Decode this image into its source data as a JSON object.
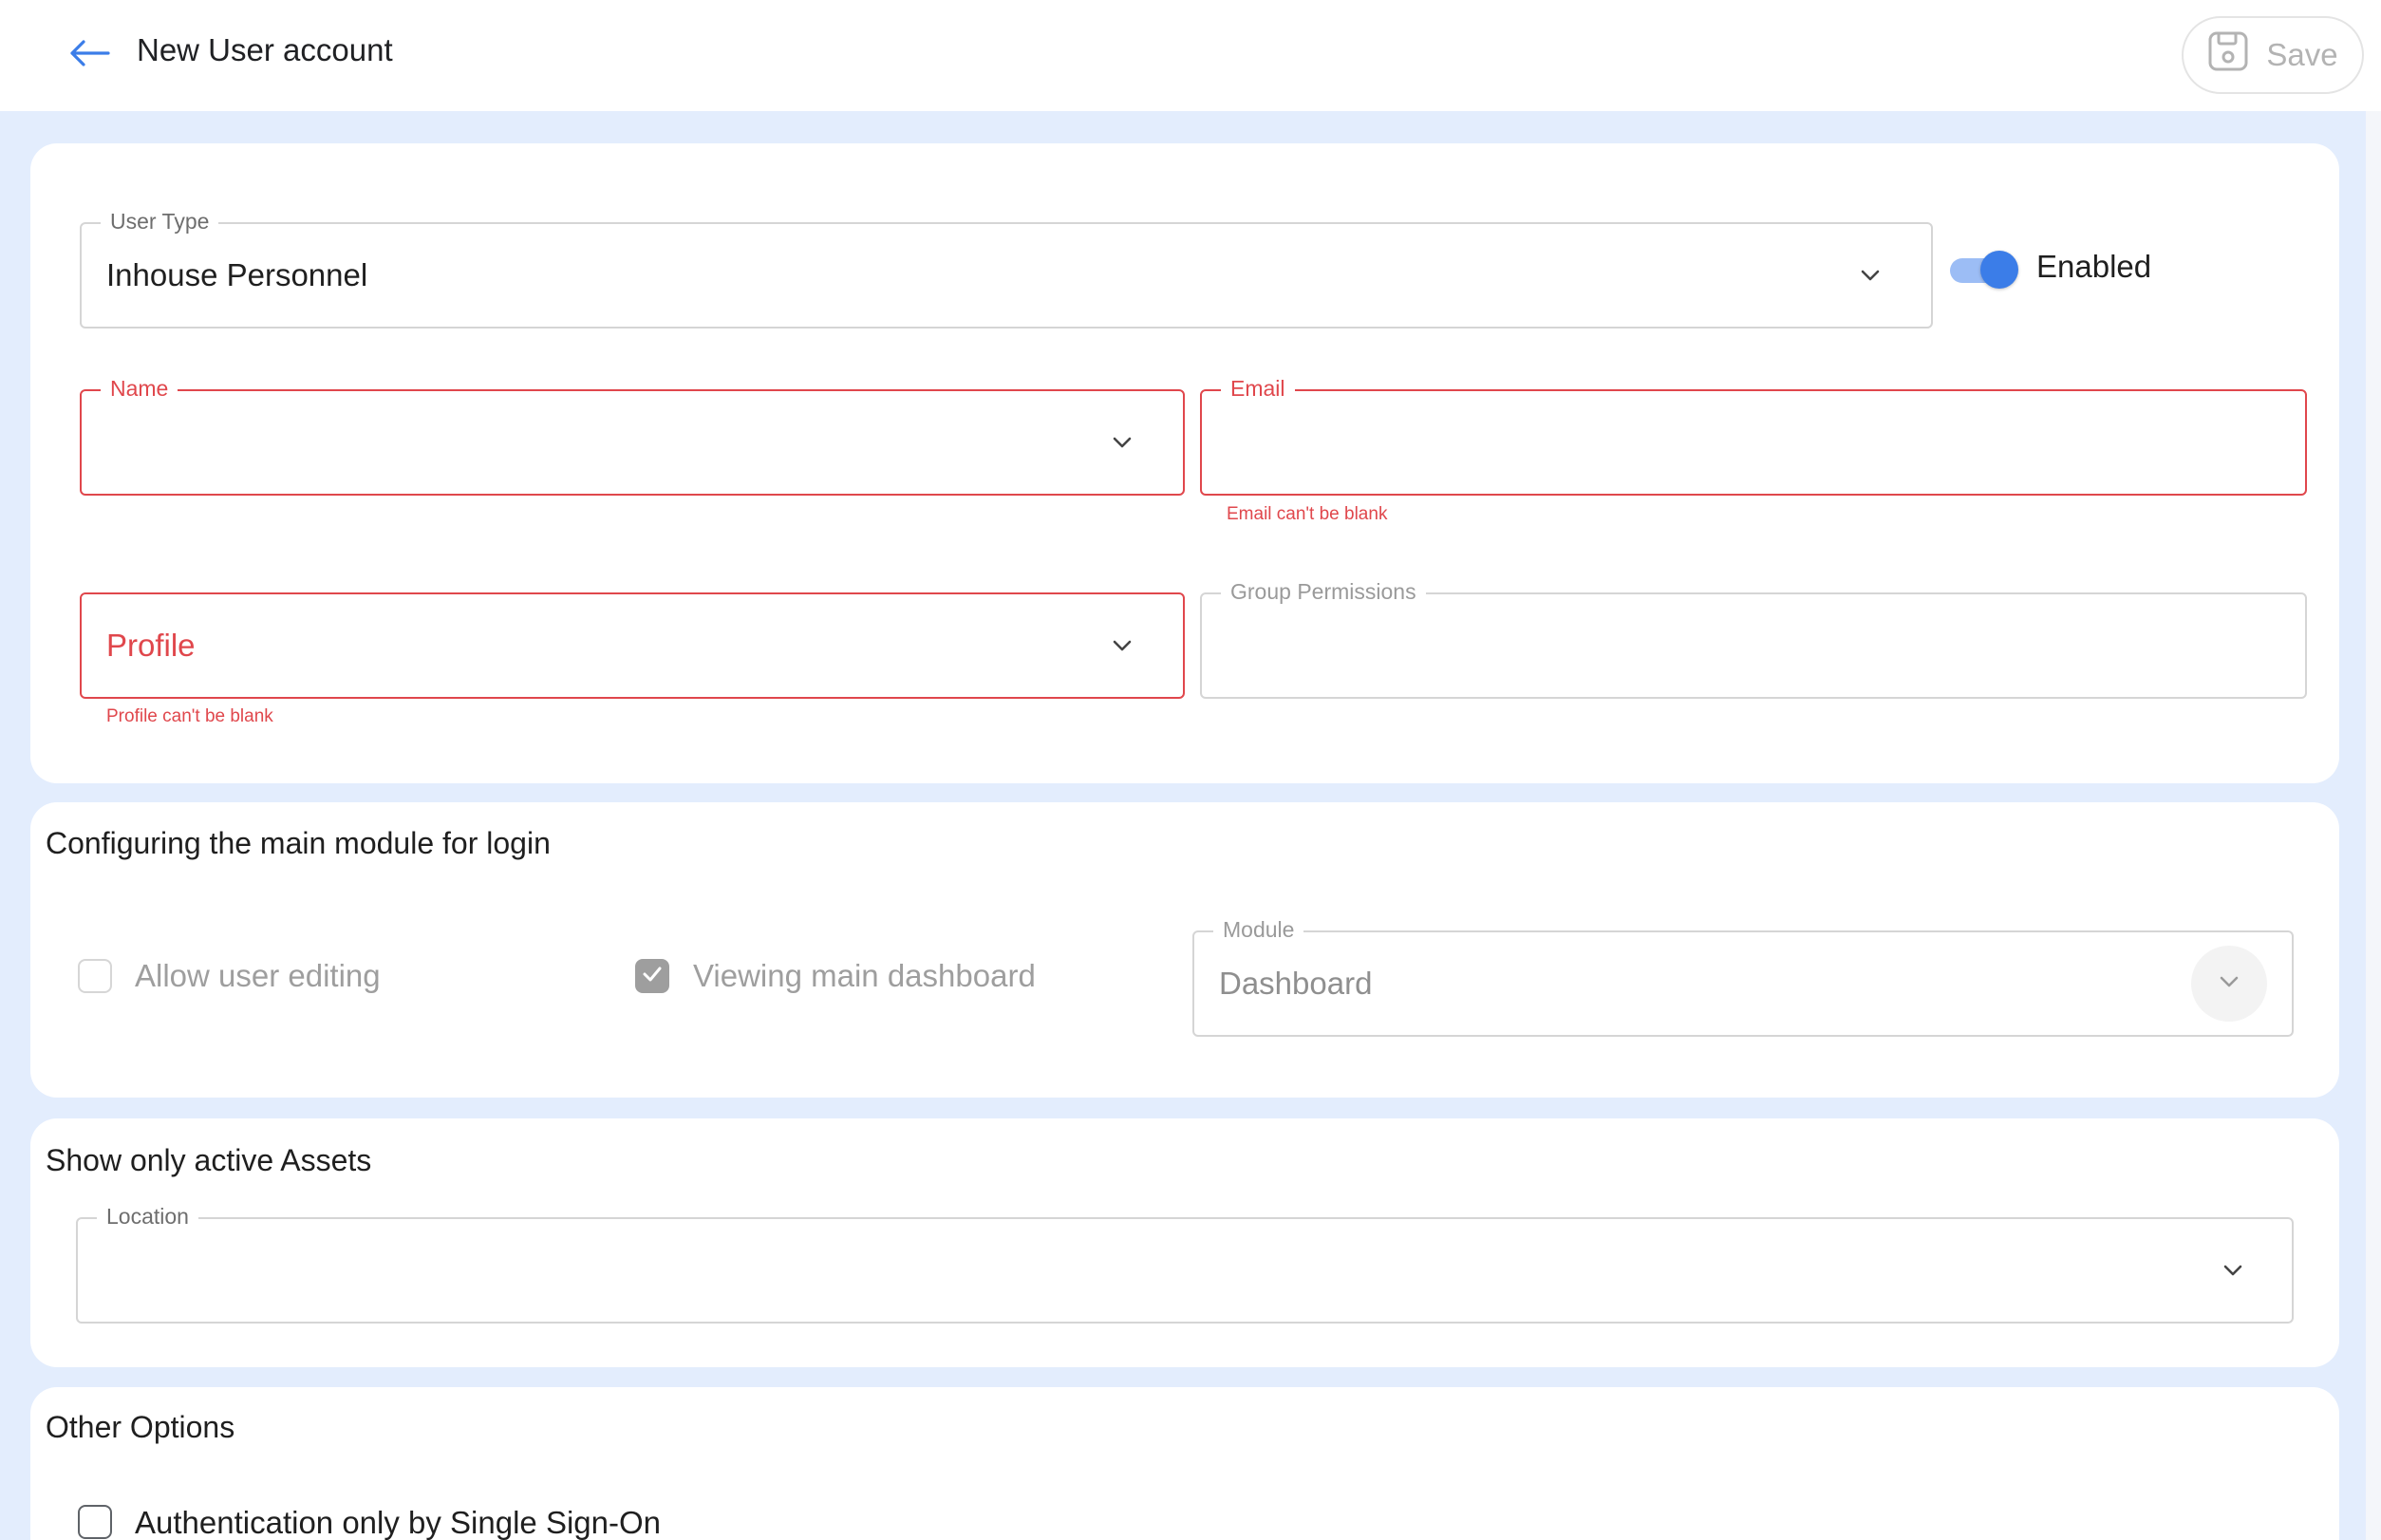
{
  "header": {
    "title": "New User account",
    "back_icon": "arrow-left-icon",
    "save_label": "Save",
    "save_icon": "floppy-disk-icon"
  },
  "colors": {
    "accent": "#3b7de8",
    "error": "#e0474c",
    "page_background": "#e3edfd",
    "disabled_text": "#9e9e9e"
  },
  "user_card": {
    "user_type": {
      "label": "User Type",
      "value": "Inhouse Personnel"
    },
    "enabled_toggle": {
      "label": "Enabled",
      "on": true
    },
    "name": {
      "label": "Name",
      "value": ""
    },
    "email": {
      "label": "Email",
      "value": "",
      "error": "Email can't be blank"
    },
    "profile": {
      "placeholder": "Profile",
      "error": "Profile can't be blank"
    },
    "group_permissions": {
      "label": "Group Permissions",
      "value": ""
    }
  },
  "module_card": {
    "title": "Configuring the main module for login",
    "allow_user_editing": {
      "label": "Allow user editing",
      "checked": false
    },
    "viewing_main_dashboard": {
      "label": "Viewing main dashboard",
      "checked": true
    },
    "module": {
      "label": "Module",
      "value": "Dashboard"
    }
  },
  "assets_card": {
    "title": "Show only active Assets",
    "location": {
      "label": "Location",
      "value": ""
    }
  },
  "other_card": {
    "title": "Other Options",
    "sso": {
      "label": "Authentication only by Single Sign-On",
      "checked": false
    }
  }
}
